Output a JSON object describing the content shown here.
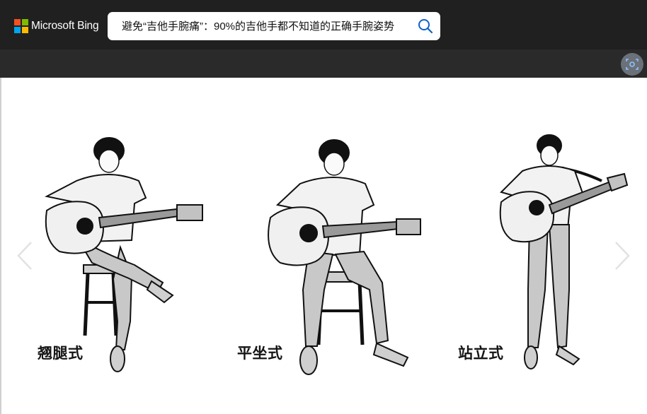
{
  "header": {
    "brand": "Microsoft Bing",
    "logo_colors": [
      "#f25022",
      "#7fba00",
      "#00a4ef",
      "#ffb900"
    ],
    "search_query": "避免“吉他手腕痛”：90%的吉他手都不知道的正确手腕姿势",
    "search_icon": "search-icon"
  },
  "subbar": {
    "visual_search_icon": "visual-search-icon"
  },
  "viewer": {
    "captions": [
      "翘腿式",
      "平坐式",
      "站立式"
    ],
    "prev_icon": "chevron-left-icon",
    "next_icon": "chevron-right-icon"
  },
  "colors": {
    "topbar": "#202020",
    "subbar": "#2a2a2a",
    "accent": "#0f62c9"
  }
}
